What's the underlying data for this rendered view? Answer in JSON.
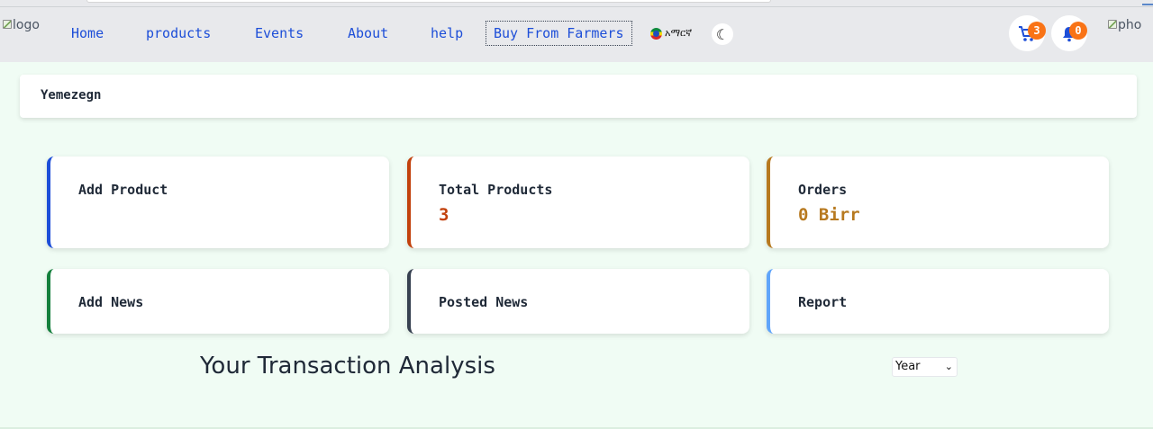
{
  "nav": {
    "logo_alt": "logo",
    "links": [
      "Home",
      "products",
      "Events",
      "About",
      "help"
    ],
    "buy_from_farmers": "Buy From Farmers",
    "language": "አማርኛ",
    "theme_icon": "moon-icon",
    "cart_count": "3",
    "notification_count": "0",
    "avatar_alt": "pho"
  },
  "brand": {
    "name": "Yemezegn"
  },
  "cards": [
    {
      "title": "Add Product",
      "value": "",
      "accent": "#1d4ed8"
    },
    {
      "title": "Total Products",
      "value": "3",
      "accent": "#c2410c",
      "value_color": "#c2410c"
    },
    {
      "title": "Orders",
      "value": "0 Birr",
      "accent": "#b7791f",
      "value_color": "#b7791f"
    },
    {
      "title": "Add News",
      "accent": "#15803d"
    },
    {
      "title": "Posted News",
      "accent": "#374151"
    },
    {
      "title": "Report",
      "accent": "#60a5fa"
    }
  ],
  "analysis": {
    "title": "Your Transaction Analysis",
    "select_value": "Year"
  },
  "colors": {
    "navbar_bg": "#e8e9ec",
    "page_bg": "#f0fcf4",
    "link": "#1d4ed8",
    "badge": "#f97316"
  }
}
